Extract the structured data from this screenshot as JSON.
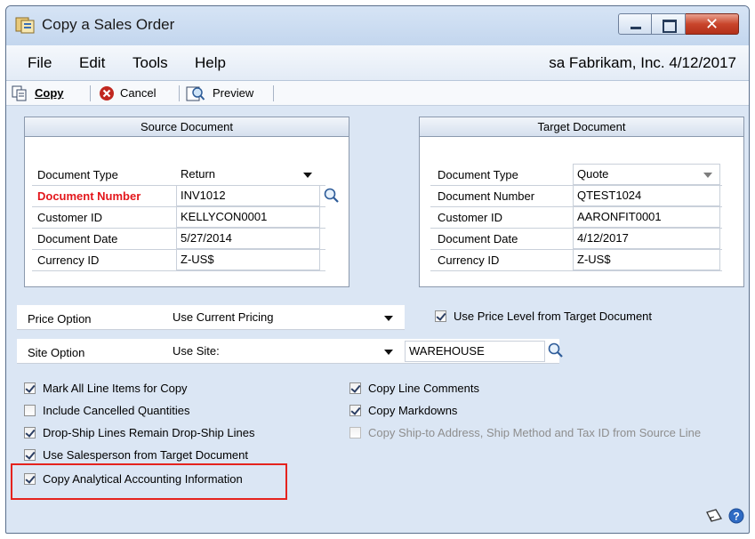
{
  "window": {
    "title": "Copy a Sales Order"
  },
  "menu": {
    "items": [
      "File",
      "Edit",
      "Tools",
      "Help"
    ]
  },
  "status": {
    "user": "sa",
    "company": "Fabrikam, Inc.",
    "date": "4/12/2017"
  },
  "toolbar": {
    "copy_label": "Copy",
    "cancel_label": "Cancel",
    "preview_label": "Preview"
  },
  "source": {
    "title": "Source Document",
    "rows": [
      {
        "label": "Document Type",
        "value": "Return"
      },
      {
        "label": "Document Number",
        "value": "INV1012"
      },
      {
        "label": "Customer ID",
        "value": "KELLYCON0001"
      },
      {
        "label": "Document Date",
        "value": "5/27/2014"
      },
      {
        "label": "Currency ID",
        "value": "Z-US$"
      }
    ]
  },
  "target": {
    "title": "Target Document",
    "rows": [
      {
        "label": "Document Type",
        "value": "Quote"
      },
      {
        "label": "Document Number",
        "value": "QTEST1024"
      },
      {
        "label": "Customer ID",
        "value": "AARONFIT0001"
      },
      {
        "label": "Document Date",
        "value": "4/12/2017"
      },
      {
        "label": "Currency ID",
        "value": "Z-US$"
      }
    ]
  },
  "price_option": {
    "label": "Price Option",
    "value": "Use Current Pricing",
    "use_price_level_label": "Use Price Level from Target Document",
    "use_price_level_checked": true
  },
  "site_option": {
    "label": "Site Option",
    "value": "Use Site:",
    "site_value": "WAREHOUSE"
  },
  "options_left": [
    {
      "label": "Mark All Line Items for Copy",
      "checked": true
    },
    {
      "label": "Include Cancelled Quantities",
      "checked": false
    },
    {
      "label": "Drop-Ship Lines Remain Drop-Ship Lines",
      "checked": true
    },
    {
      "label": "Use Salesperson from Target Document",
      "checked": true
    },
    {
      "label": "Copy Analytical Accounting Information",
      "checked": true
    }
  ],
  "options_right": [
    {
      "label": "Copy Line Comments",
      "checked": true,
      "disabled": false
    },
    {
      "label": "Copy Markdowns",
      "checked": true,
      "disabled": false
    },
    {
      "label": "Copy Ship-to Address, Ship Method and Tax ID from Source Line",
      "checked": false,
      "disabled": true
    }
  ],
  "colors": {
    "required_label": "#e3161b",
    "highlight": "#e5231e",
    "accent": "#2f6bc4"
  }
}
